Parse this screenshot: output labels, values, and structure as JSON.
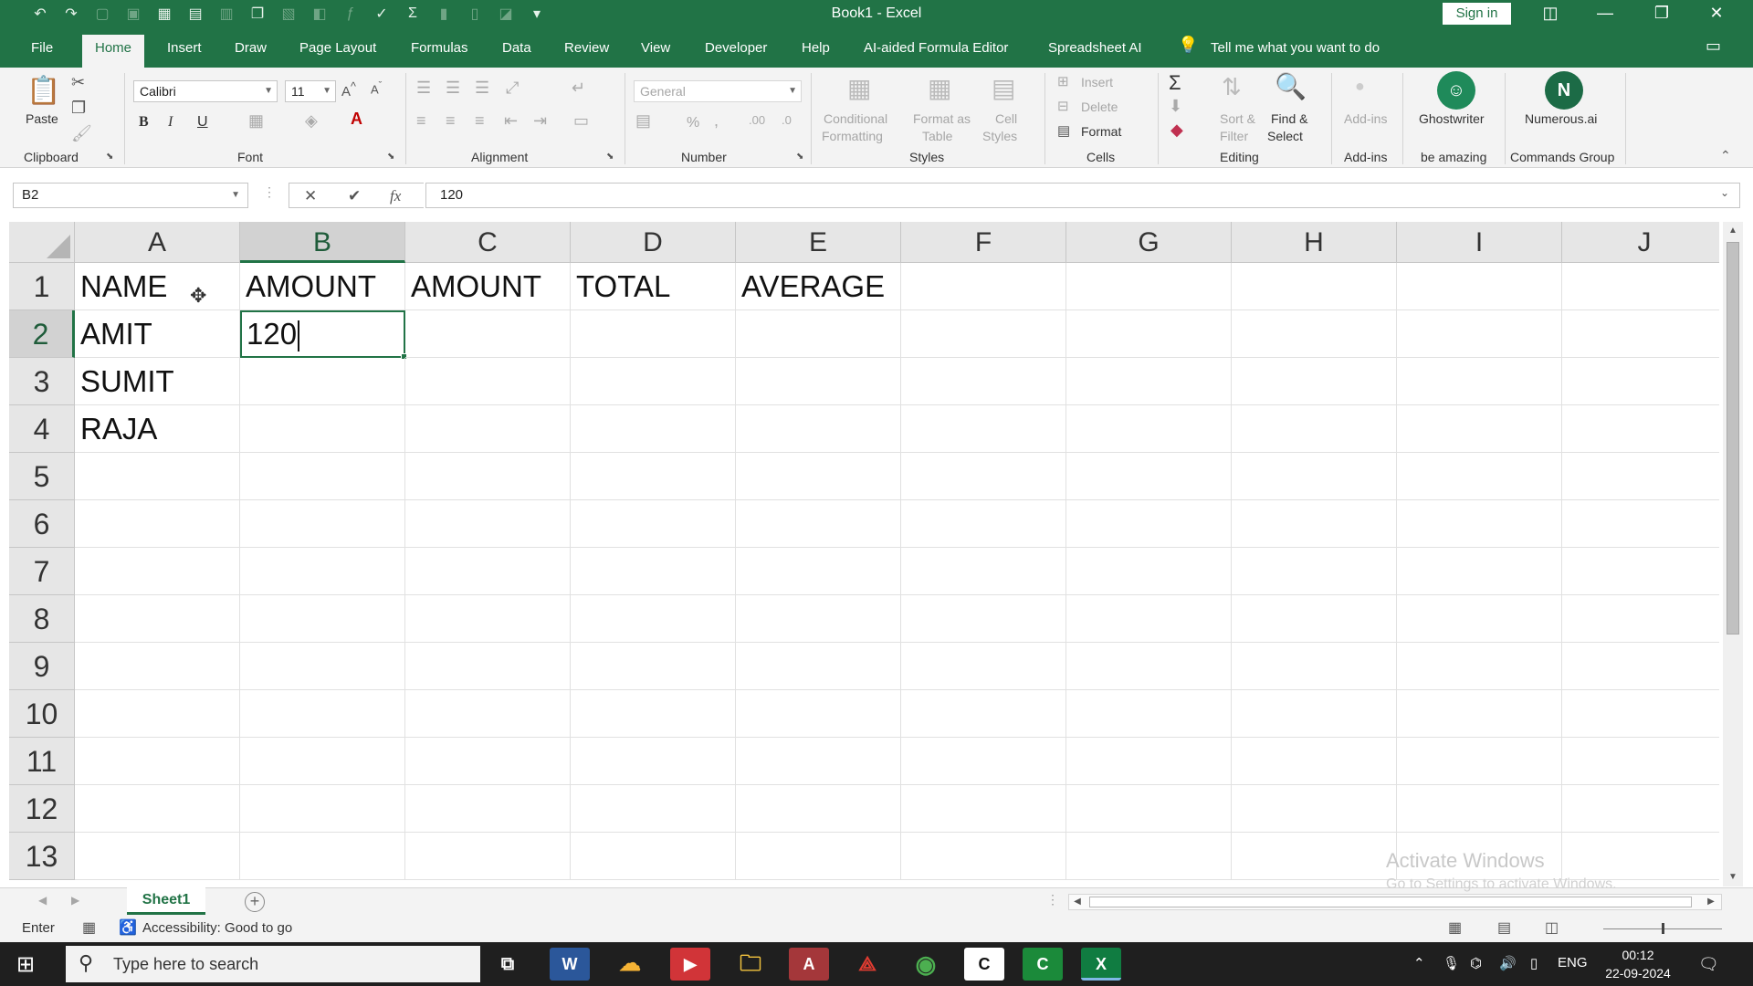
{
  "window": {
    "title": "Book1  -  Excel",
    "sign_in": "Sign in"
  },
  "qat": {
    "icons": [
      "undo-icon",
      "redo-icon",
      "new-icon",
      "lock-icon",
      "grid-icon",
      "save-icon"
    ]
  },
  "tabs": [
    "File",
    "Home",
    "Insert",
    "Draw",
    "Page Layout",
    "Formulas",
    "Data",
    "Review",
    "View",
    "Developer",
    "Help",
    "AI-aided Formula Editor",
    "Spreadsheet AI"
  ],
  "active_tab": "Home",
  "tell_me": "Tell me what you want to do",
  "ribbon": {
    "clipboard": {
      "paste": "Paste",
      "label": "Clipboard"
    },
    "font": {
      "name": "Calibri",
      "size": "11",
      "label": "Font",
      "bold": "B",
      "italic": "I",
      "underline": "U"
    },
    "alignment": {
      "label": "Alignment"
    },
    "number": {
      "format": "General",
      "label": "Number",
      "percent": "%"
    },
    "styles": {
      "conditional": "Conditional",
      "formatting": "Formatting",
      "format_as": "Format as",
      "table": "Table",
      "cell": "Cell",
      "styles_word": "Styles",
      "label": "Styles"
    },
    "cells": {
      "insert": "Insert",
      "delete": "Delete",
      "format": "Format",
      "label": "Cells"
    },
    "editing": {
      "sort": "Sort &",
      "filter": "Filter",
      "find": "Find &",
      "select": "Select",
      "label": "Editing"
    },
    "addins": {
      "addins": "Add-ins",
      "label": "Add-ins"
    },
    "ghostwriter": {
      "name": "Ghostwriter",
      "label": "be amazing"
    },
    "numerous": {
      "name": "Numerous.ai",
      "label": "Commands Group"
    }
  },
  "formula_bar": {
    "name_box": "B2",
    "value": "120",
    "fx": "fx"
  },
  "grid": {
    "columns": [
      "A",
      "B",
      "C",
      "D",
      "E",
      "F",
      "G",
      "H",
      "I",
      "J"
    ],
    "selected_column": "B",
    "rows": [
      "1",
      "2",
      "3",
      "4",
      "5",
      "6",
      "7",
      "8",
      "9",
      "10",
      "11",
      "12",
      "13"
    ],
    "selected_row": "2",
    "cells": {
      "A1": "NAME",
      "B1": "AMOUNT",
      "C1": "AMOUNT",
      "D1": "TOTAL",
      "E1": "AVERAGE",
      "A2": "AMIT",
      "B2": "120",
      "A3": "SUMIT",
      "A4": "RAJA"
    },
    "active_cell": "B2"
  },
  "sheets": {
    "tabs": [
      "Sheet1"
    ],
    "active": "Sheet1"
  },
  "status": {
    "mode": "Enter",
    "accessibility": "Accessibility: Good to go"
  },
  "watermark": {
    "line1": "Activate Windows",
    "line2": "Go to Settings to activate Windows."
  },
  "taskbar": {
    "search_placeholder": "Type here to search",
    "language": "ENG",
    "time": "00:12",
    "date": "22-09-2024"
  },
  "colors": {
    "excel_green": "#217346",
    "taskbar": "#1f1f1f"
  }
}
